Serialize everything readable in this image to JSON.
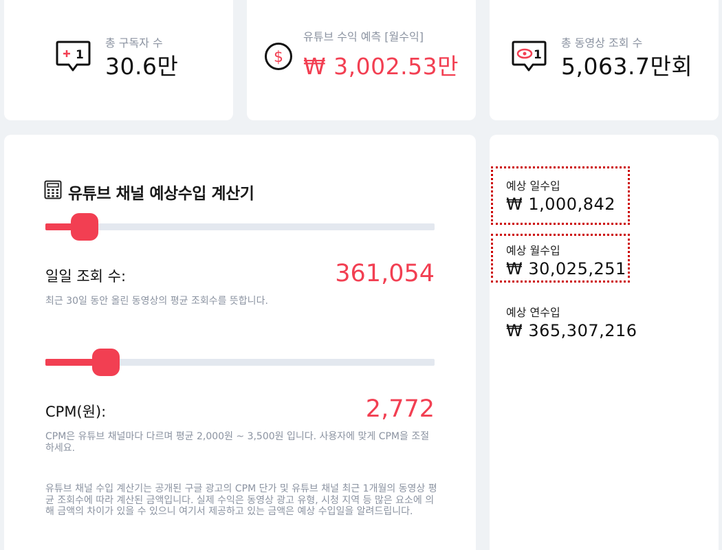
{
  "stats": {
    "subscribers": {
      "label": "총 구독자 수",
      "value": "30.6만",
      "icon": "chat-plus-one-icon"
    },
    "revenue": {
      "label": "유튜브 수익 예측 [월수익]",
      "value": "₩ 3,002.53만",
      "icon": "dollar-circle-icon"
    },
    "views": {
      "label": "총 동영상 조회 수",
      "value": "5,063.7만회",
      "icon": "chat-eye-icon"
    }
  },
  "calculator": {
    "title": "유튜브 채널 예상수입 계산기",
    "icon": "calculator-icon",
    "daily_views": {
      "label": "일일 조회 수:",
      "value": "361,054",
      "slider_fraction": 0.07,
      "description": "최근 30일 동안 올린 동영상의 평균 조회수를 뜻합니다."
    },
    "cpm": {
      "label": "CPM(원):",
      "value": "2,772",
      "slider_fraction": 0.13,
      "description": "CPM은 유튜브 채널마다 다르며 평균 2,000원 ~ 3,500원 입니다. 사용자에 맞게 CPM을 조절하세요."
    },
    "notice": "유튜브 채널 수입 계산기는 공개된 구글 광고의 CPM 단가 및 유튜브 채널 최근 1개월의 동영상 평균 조회수에 따라 계산된 금액입니다. 실제 수익은 동영상 광고 유형, 시청 지역 등 많은 요소에 의해 금액의 차이가 있을 수 있으니 여기서 제공하고 있는 금액은 예상 수입일을 알려드립니다."
  },
  "income": {
    "daily": {
      "label": "예상 일수입",
      "value": "₩ 1,000,842"
    },
    "monthly": {
      "label": "예상 월수입",
      "value": "₩ 30,025,251"
    },
    "yearly": {
      "label": "예상 연수입",
      "value": "₩ 365,307,216"
    }
  },
  "colors": {
    "accent": "#f23f52",
    "background": "#eff2f5",
    "muted_text": "#8b93a1",
    "track": "#e3e8ef",
    "highlight_border": "#cc0000"
  }
}
